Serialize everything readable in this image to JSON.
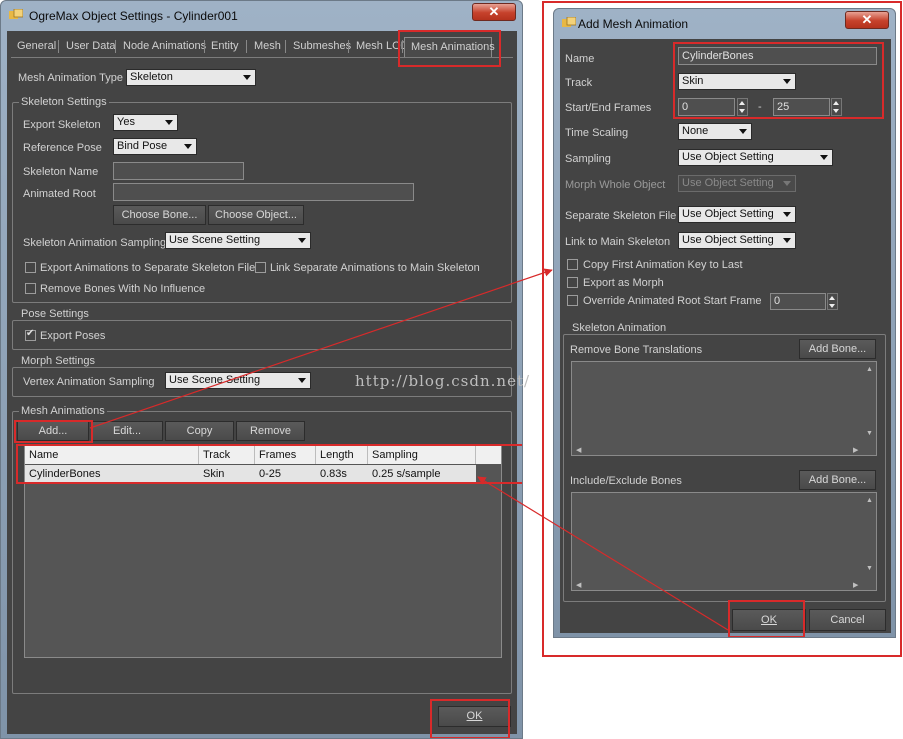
{
  "main_window": {
    "title": "OgreMax Object Settings - Cylinder001",
    "close_label": "✕",
    "tabs": [
      "General",
      "User Data",
      "Node Animations",
      "Entity",
      "Mesh",
      "Submeshes",
      "Mesh LOD",
      "Mesh Animations"
    ],
    "active_tab": "Mesh Animations",
    "mesh_animation_type_label": "Mesh Animation Type",
    "mesh_animation_type_value": "Skeleton",
    "skeleton_settings": {
      "title": "Skeleton Settings",
      "export_skeleton_label": "Export Skeleton",
      "export_skeleton_value": "Yes",
      "reference_pose_label": "Reference Pose",
      "reference_pose_value": "Bind Pose",
      "skeleton_name_label": "Skeleton Name",
      "animated_root_label": "Animated Root",
      "choose_bone_label": "Choose Bone...",
      "choose_object_label": "Choose Object...",
      "sampling_label": "Skeleton Animation Sampling",
      "sampling_value": "Use Scene Setting",
      "export_separate_label": "Export Animations to Separate Skeleton Files",
      "link_separate_label": "Link Separate Animations to Main Skeleton",
      "remove_bones_label": "Remove Bones With No Influence"
    },
    "pose_settings": {
      "title": "Pose Settings",
      "export_poses_label": "Export Poses"
    },
    "morph_settings": {
      "title": "Morph Settings",
      "vertex_sampling_label": "Vertex Animation Sampling",
      "vertex_sampling_value": "Use Scene Setting"
    },
    "mesh_animations": {
      "title": "Mesh Animations",
      "add_label": "Add...",
      "edit_label": "Edit...",
      "copy_label": "Copy",
      "remove_label": "Remove",
      "columns": [
        "Name",
        "Track",
        "Frames",
        "Length",
        "Sampling"
      ],
      "rows": [
        [
          "CylinderBones",
          "Skin",
          "0-25",
          "0.83s",
          "0.25 s/sample"
        ]
      ]
    },
    "ok_label": "OK"
  },
  "dialog": {
    "title": "Add Mesh Animation",
    "close_label": "✕",
    "name_label": "Name",
    "name_value": "CylinderBones",
    "track_label": "Track",
    "track_value": "Skin",
    "frames_label": "Start/End Frames",
    "start_frame": "0",
    "frames_separator": "-",
    "end_frame": "25",
    "time_scaling_label": "Time Scaling",
    "time_scaling_value": "None",
    "sampling_label": "Sampling",
    "sampling_value": "Use Object Setting",
    "morph_whole_label": "Morph Whole Object",
    "morph_whole_value": "Use Object Setting",
    "separate_skeleton_label": "Separate Skeleton File",
    "separate_skeleton_value": "Use Object Setting",
    "link_main_label": "Link to Main Skeleton",
    "link_main_value": "Use Object Setting",
    "copy_first_key_label": "Copy First Animation Key to Last",
    "export_morph_label": "Export as Morph",
    "override_root_label": "Override Animated Root Start Frame",
    "override_root_value": "0",
    "skeleton_animation_title": "Skeleton Animation",
    "remove_translations_label": "Remove Bone Translations",
    "add_bone_label": "Add Bone...",
    "include_exclude_label": "Include/Exclude Bones",
    "add_bone_label2": "Add Bone...",
    "ok_label": "OK",
    "cancel_label": "Cancel"
  },
  "watermark": "http://blog.csdn.net/",
  "annotation_color": "#d82a2a"
}
